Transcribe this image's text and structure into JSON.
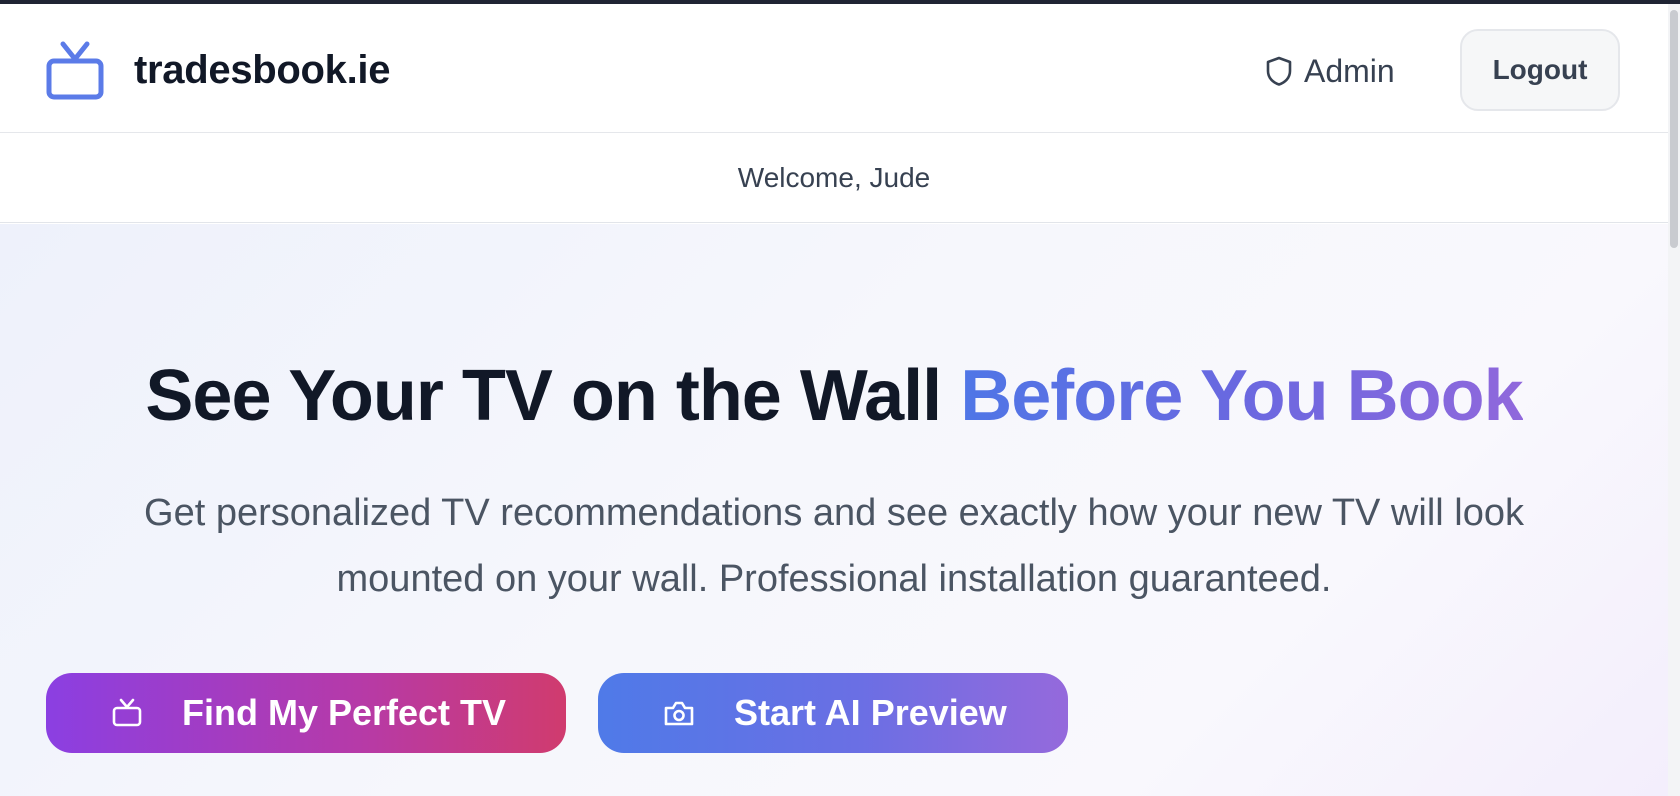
{
  "header": {
    "brand": "tradesbook.ie",
    "brand_icon": "tv-icon",
    "admin_label": "Admin",
    "admin_icon": "shield-icon",
    "logout_label": "Logout"
  },
  "welcome": {
    "text": "Welcome, Jude"
  },
  "hero": {
    "headline_main": "See Your TV on the Wall",
    "headline_accent": "Before You Book",
    "subtext": "Get personalized TV recommendations and see exactly how your new TV will look mounted on your wall. Professional installation guaranteed.",
    "buttons": [
      {
        "label": "Find My Perfect TV",
        "icon": "tv-icon"
      },
      {
        "label": "Start AI Preview",
        "icon": "camera-icon"
      }
    ]
  },
  "colors": {
    "brand_blue": "#4f76e6",
    "accent_purple": "#9068dc",
    "button_tv_start": "#8b3fe2",
    "button_tv_end": "#d03b6e",
    "button_ai_start": "#4f7ae8",
    "button_ai_end": "#9569dc"
  }
}
